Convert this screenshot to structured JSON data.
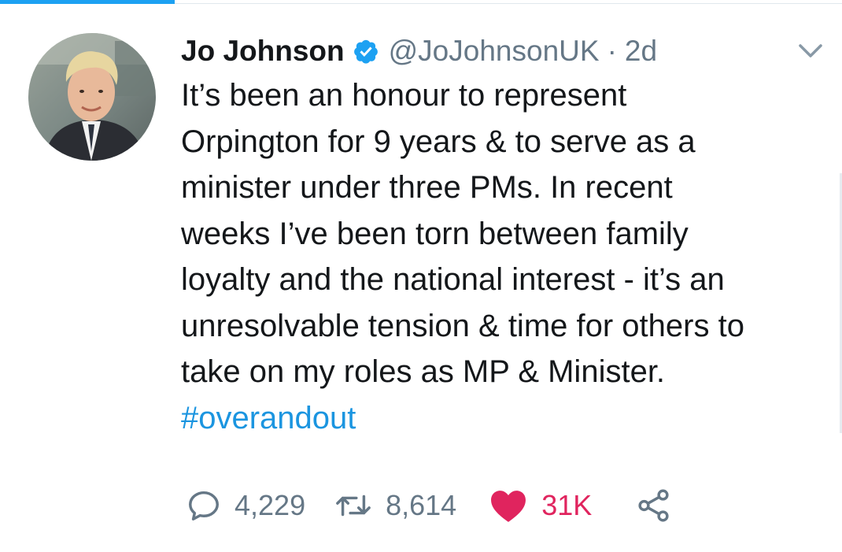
{
  "tweet": {
    "author": {
      "display_name": "Jo Johnson",
      "verified_icon": "verified-badge-icon",
      "handle": "@JoJohnsonUK",
      "separator": "·",
      "time": "2d"
    },
    "text_lines": [
      "It’s been an honour to represent",
      "Orpington for 9 years & to serve as a",
      "minister under three PMs. In recent",
      "weeks I’ve been torn between family",
      "loyalty and the national interest - it’s an",
      "unresolvable tension & time for others to",
      "take on my roles as MP & Minister."
    ],
    "hashtag": "#overandout",
    "stats": {
      "replies": "4,229",
      "retweets": "8,614",
      "likes": "31K"
    }
  },
  "icons": {
    "reply": "reply-icon",
    "retweet": "retweet-icon",
    "like": "heart-icon",
    "share": "share-icon",
    "menu": "chevron-down-icon"
  },
  "colors": {
    "accent": "#1da1f2",
    "hashtag": "#1b95e0",
    "muted": "#657786",
    "like": "#e0245e",
    "text": "#14171a"
  }
}
